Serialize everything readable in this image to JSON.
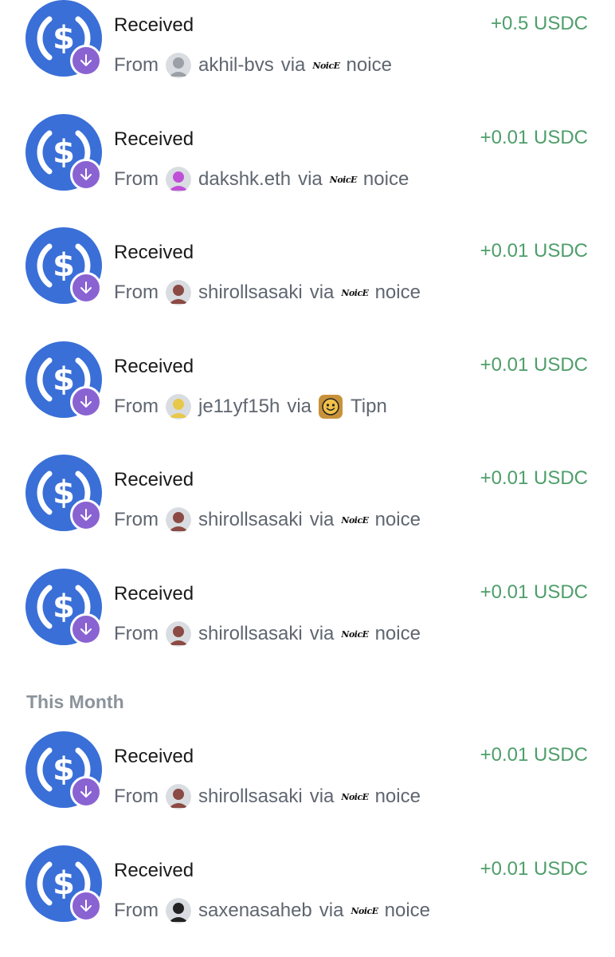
{
  "colors": {
    "usdc_blue": "#3a6fd8",
    "badge_purple": "#8a63d2",
    "amount_green": "#4e9e6a",
    "muted_text": "#5f6670",
    "section_label": "#8b939b"
  },
  "icons": {
    "coin": "usdc-icon",
    "badge": "arrow-down-icon"
  },
  "labels": {
    "from": "From",
    "via": "via"
  },
  "section_header": "This Month",
  "transactions": [
    {
      "title": "Received",
      "amount": "+0.5 USDC",
      "user": "akhil-bvs",
      "avatar_color": "#9aa0a6",
      "app": "noice",
      "app_logo": "NoicE"
    },
    {
      "title": "Received",
      "amount": "+0.01 USDC",
      "user": "dakshk.eth",
      "avatar_color": "#c04fd8",
      "app": "noice",
      "app_logo": "NoicE"
    },
    {
      "title": "Received",
      "amount": "+0.01 USDC",
      "user": "shirollsasaki",
      "avatar_color": "#8b4a43",
      "app": "noice",
      "app_logo": "NoicE"
    },
    {
      "title": "Received",
      "amount": "+0.01 USDC",
      "user": "je11yf15h",
      "avatar_color": "#e8c84a",
      "app": "Tipn",
      "app_logo": "tipn-logo"
    },
    {
      "title": "Received",
      "amount": "+0.01 USDC",
      "user": "shirollsasaki",
      "avatar_color": "#8b4a43",
      "app": "noice",
      "app_logo": "NoicE"
    },
    {
      "title": "Received",
      "amount": "+0.01 USDC",
      "user": "shirollsasaki",
      "avatar_color": "#8b4a43",
      "app": "noice",
      "app_logo": "NoicE"
    },
    {
      "title": "Received",
      "amount": "+0.01 USDC",
      "user": "shirollsasaki",
      "avatar_color": "#8b4a43",
      "app": "noice",
      "app_logo": "NoicE"
    },
    {
      "title": "Received",
      "amount": "+0.01 USDC",
      "user": "saxenasaheb",
      "avatar_color": "#222222",
      "app": "noice",
      "app_logo": "NoicE"
    }
  ]
}
